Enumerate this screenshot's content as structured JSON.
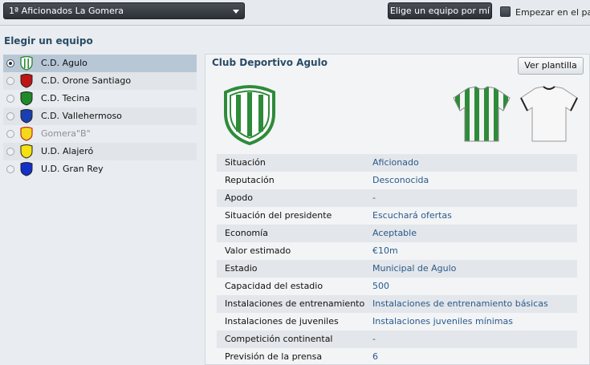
{
  "header": {
    "league_select": "1ª Aficionados La Gomera",
    "choose_button": "Elige un equipo por mí",
    "start_label": "Empezar en el paro"
  },
  "left": {
    "title": "Elegir un equipo",
    "teams": [
      {
        "name": "C.D. Agulo",
        "crest": "green-striped-crest-icon",
        "color": "#2e8b3a",
        "selected": true,
        "disabled": false
      },
      {
        "name": "C.D. Orone Santiago",
        "crest": "red-crest-icon",
        "color": "#c01515",
        "selected": false,
        "disabled": false
      },
      {
        "name": "C.D. Tecina",
        "crest": "green-crest-icon",
        "color": "#1f8a2a",
        "selected": false,
        "disabled": false
      },
      {
        "name": "C.D. Vallehermoso",
        "crest": "blue-crest-icon",
        "color": "#1a3fb0",
        "selected": false,
        "disabled": false
      },
      {
        "name": "Gomera\"B\"",
        "crest": "yellow-crest-icon",
        "color": "#f2d91a",
        "selected": false,
        "disabled": true
      },
      {
        "name": "U.D. Alajeró",
        "crest": "yellow-crest-icon",
        "color": "#f5e010",
        "selected": false,
        "disabled": false
      },
      {
        "name": "U.D. Gran Rey",
        "crest": "blue-crest-icon",
        "color": "#1330c8",
        "selected": false,
        "disabled": false
      }
    ]
  },
  "panel": {
    "club_name": "Club Deportivo Agulo",
    "squad_button": "Ver plantilla",
    "info": [
      {
        "key": "Situación",
        "value": "Aficionado"
      },
      {
        "key": "Reputación",
        "value": "Desconocida"
      },
      {
        "key": "Apodo",
        "value": "-"
      },
      {
        "key": "Situación del presidente",
        "value": "Escuchará ofertas"
      },
      {
        "key": "Economía",
        "value": "Aceptable"
      },
      {
        "key": "Valor estimado",
        "value": "€10m"
      },
      {
        "key": "Estadio",
        "value": "Municipal de Agulo"
      },
      {
        "key": "Capacidad del estadio",
        "value": "500"
      },
      {
        "key": "Instalaciones de entrenamiento",
        "value": "Instalaciones de entrenamiento básicas"
      },
      {
        "key": "Instalaciones de juveniles",
        "value": "Instalaciones juveniles mínimas"
      },
      {
        "key": "Competición continental",
        "value": "-"
      },
      {
        "key": "Previsión de la prensa",
        "value": "6"
      }
    ]
  }
}
